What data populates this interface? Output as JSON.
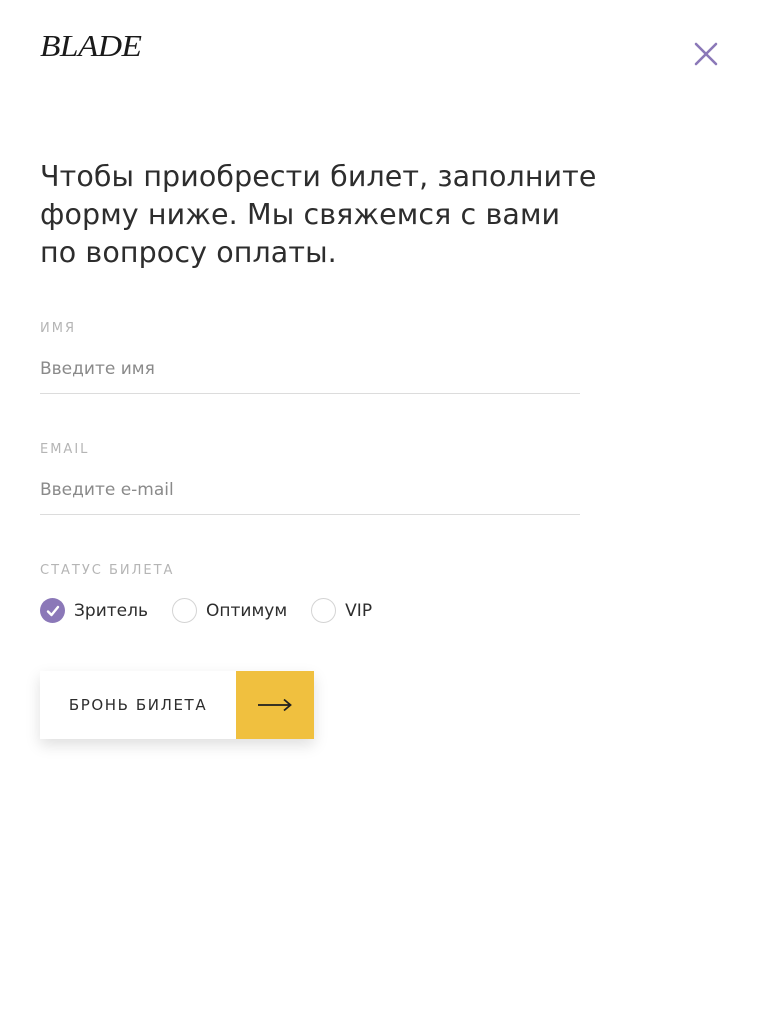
{
  "header": {
    "logo_text": "BLADE",
    "close_icon": "close-icon"
  },
  "headline": "Чтобы приобрести билет, заполните форму ниже. Мы свяжемся с вами по вопросу оплаты.",
  "form": {
    "name": {
      "label": "ИМЯ",
      "placeholder": "Введите имя",
      "value": ""
    },
    "email": {
      "label": "EMAIL",
      "placeholder": "Введите e-mail",
      "value": ""
    },
    "ticket_status": {
      "label": "СТАТУС БИЛЕТА",
      "options": [
        {
          "label": "Зритель",
          "checked": true
        },
        {
          "label": "Оптимум",
          "checked": false
        },
        {
          "label": "VIP",
          "checked": false
        }
      ]
    },
    "submit": {
      "label": "БРОНЬ БИЛЕТА",
      "icon": "arrow-right-icon"
    }
  },
  "colors": {
    "accent": "#8b78b8",
    "button_accent": "#f0c03f",
    "label_gray": "#b5b5b5",
    "divider": "#dcdcdc"
  }
}
